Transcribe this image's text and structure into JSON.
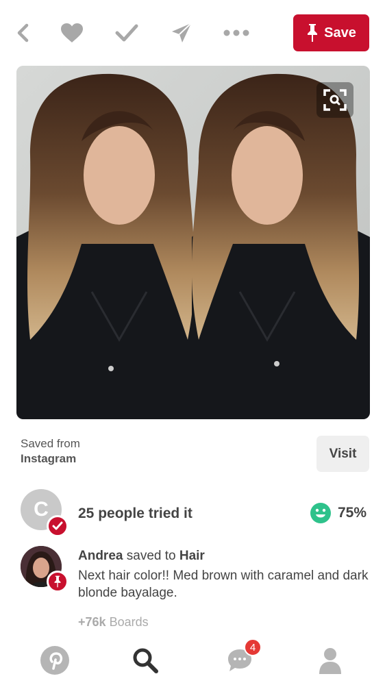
{
  "toolbar": {
    "back_icon": "chevron-left-icon",
    "like_icon": "heart-icon",
    "done_icon": "check-icon",
    "send_icon": "paper-plane-icon",
    "more_icon": "more-dots-icon",
    "save_label": "Save",
    "save_color": "#c8102e"
  },
  "pin": {
    "image": "photo of a woman with long brown hair with caramel and dark blonde balayage, mirrored",
    "lens_icon": "visual-search-icon"
  },
  "source": {
    "label": "Saved from",
    "name": "Instagram",
    "visit_label": "Visit"
  },
  "tried": {
    "avatar_letter": "C",
    "text": "25 people tried it",
    "score": "75%",
    "score_color": "#2ec28b"
  },
  "activity": {
    "user": "Andrea",
    "action": "saved to",
    "board": "Hair",
    "description": "Next hair color!! Med brown with caramel and dark blonde bayalage.",
    "boards_count": "+76k",
    "boards_label": "Boards"
  },
  "nav": {
    "home_icon": "pinterest-logo-icon",
    "search_icon": "search-icon",
    "messages_icon": "chat-bubble-icon",
    "messages_badge": "4",
    "profile_icon": "person-icon"
  }
}
